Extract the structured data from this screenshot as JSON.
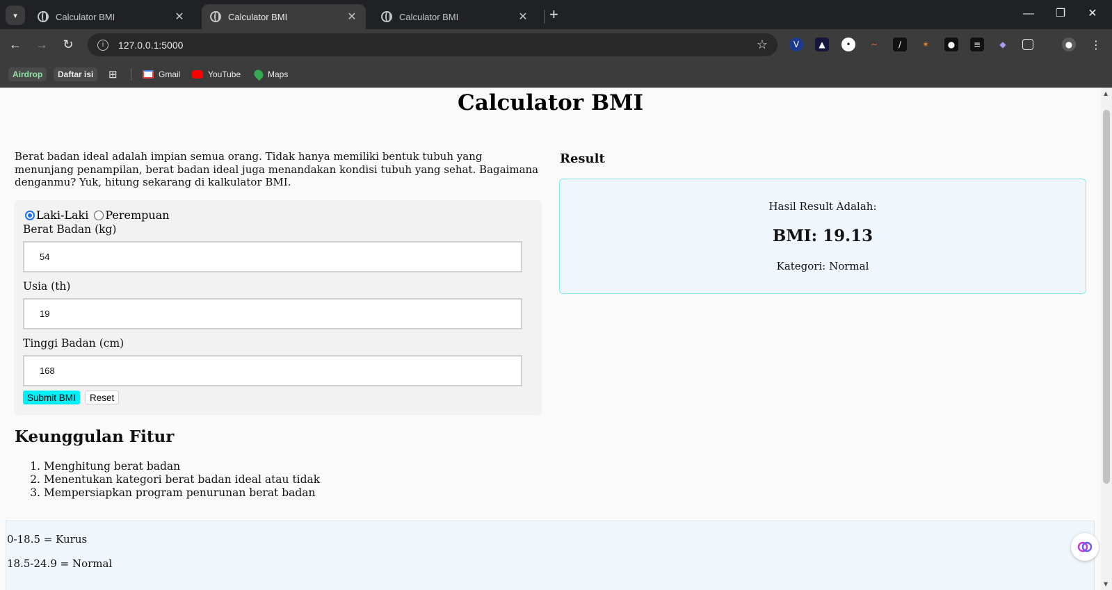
{
  "browser": {
    "tabs": [
      {
        "title": "Calculator BMI",
        "active": false
      },
      {
        "title": "Calculator BMI",
        "active": true
      },
      {
        "title": "Calculator BMI",
        "active": false
      }
    ],
    "url": "127.0.0.1:5000",
    "bookmarks": [
      {
        "label": "Airdrop"
      },
      {
        "label": "Daftar isi"
      },
      {
        "label": "Gmail"
      },
      {
        "label": "YouTube"
      },
      {
        "label": "Maps"
      }
    ],
    "icons": {
      "tab_search": "▾",
      "close": "✕",
      "new_tab": "+",
      "minimize": "—",
      "restore": "❐",
      "window_close": "✕",
      "back": "←",
      "forward": "→",
      "reload": "↻",
      "info": "i",
      "star": "☆",
      "menu": "⋮",
      "apps": "⊞"
    }
  },
  "page": {
    "title": "Calculator BMI",
    "intro": "Berat badan ideal adalah impian semua orang. Tidak hanya memiliki bentuk tubuh yang menunjang penampilan, berat badan ideal juga menandakan kondisi tubuh yang sehat. Bagaimana denganmu? Yuk, hitung sekarang di kalkulator BMI.",
    "form": {
      "gender_options": [
        "Laki-Laki",
        "Perempuan"
      ],
      "gender_selected": "Laki-Laki",
      "weight_label": "Berat Badan (kg)",
      "weight_value": "54",
      "age_label": "Usia (th)",
      "age_value": "19",
      "height_label": "Tinggi Badan (cm)",
      "height_value": "168",
      "submit_label": "Submit BMI",
      "reset_label": "Reset"
    },
    "result": {
      "heading": "Result",
      "caption": "Hasil Result Adalah:",
      "bmi": "BMI: 19.13",
      "category": "Kategori: Normal"
    },
    "features": {
      "title": "Keunggulan Fitur",
      "items": [
        "Menghitung berat badan",
        "Menentukan kategori berat badan ideal atau tidak",
        "Mempersiapkan program penurunan berat badan"
      ]
    },
    "legend": [
      "0-18.5 = Kurus",
      "18.5-24.9 = Normal"
    ]
  },
  "colors": {
    "submit_button": "#00f0f5",
    "result_border": "#7eedf2",
    "result_bg": "#eff6fc",
    "radio_accent": "#1a73e8"
  }
}
